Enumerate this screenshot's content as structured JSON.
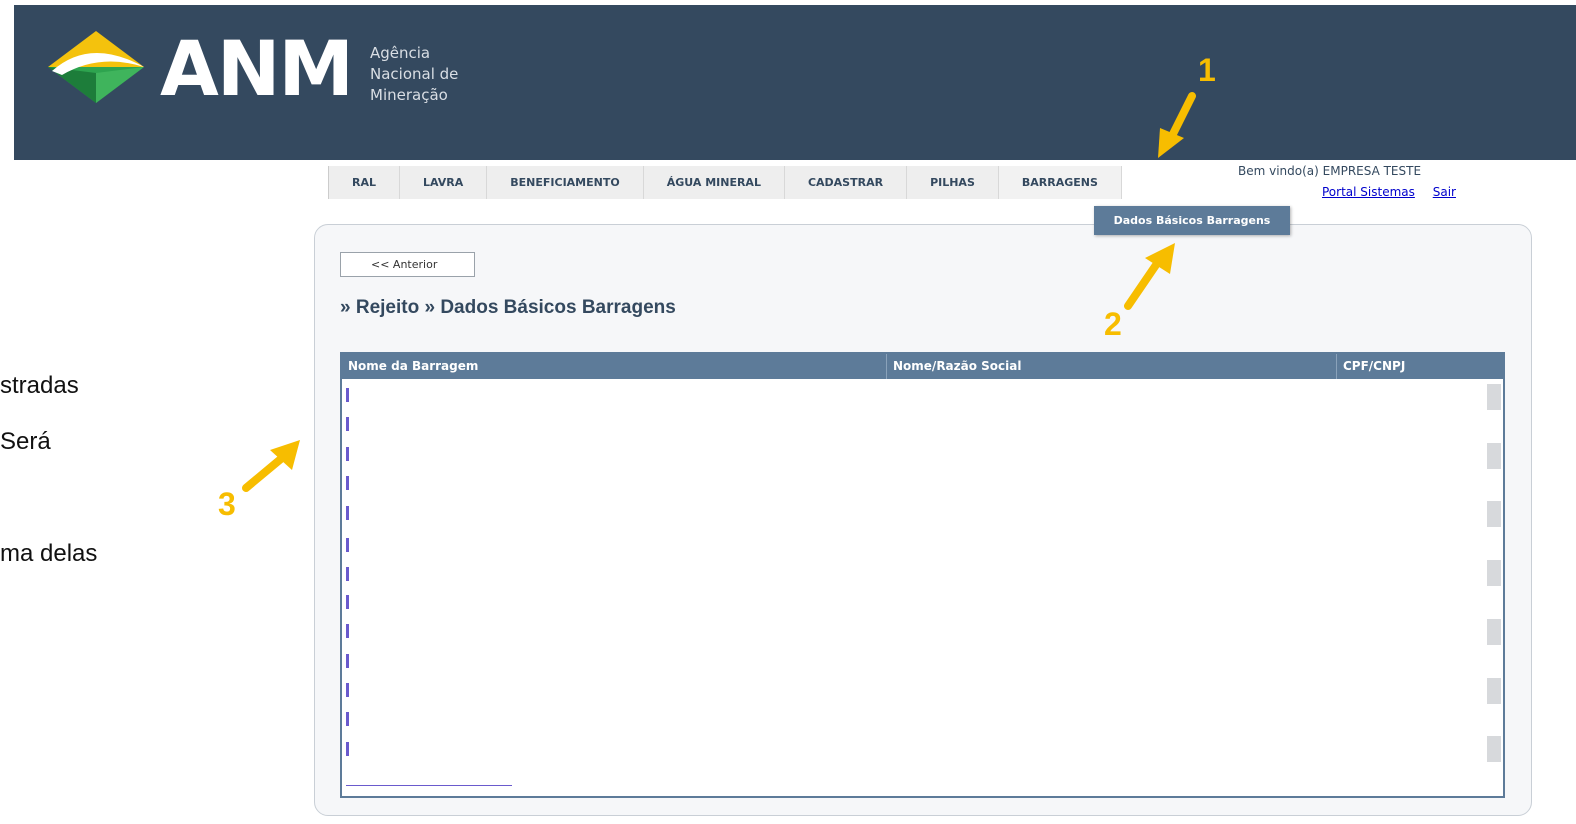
{
  "header": {
    "logo_text": "ANM",
    "logo_sub_1": "Agência",
    "logo_sub_2": "Nacional de",
    "logo_sub_3": "Mineração"
  },
  "nav": {
    "items": [
      "RAL",
      "LAVRA",
      "BENEFICIAMENTO",
      "ÁGUA MINERAL",
      "CADASTRAR",
      "PILHAS",
      "BARRAGENS"
    ],
    "welcome": "Bem vindo(a) EMPRESA TESTE",
    "portal_link": "Portal Sistemas",
    "exit_link": "Sair",
    "dropdown_item": "Dados Básicos Barragens"
  },
  "page": {
    "prev_button": "<< Anterior",
    "breadcrumb": "» Rejeito » Dados Básicos Barragens"
  },
  "table": {
    "columns": [
      "Nome da Barragem",
      "Nome/Razão Social",
      "CPF/CNPJ"
    ]
  },
  "annotations": {
    "n1": "1",
    "n2": "2",
    "n3": "3",
    "side_line_1": "stradas",
    "side_line_2": " Será",
    "side_line_3": "ma delas",
    "accent_color": "#f7bd00"
  }
}
